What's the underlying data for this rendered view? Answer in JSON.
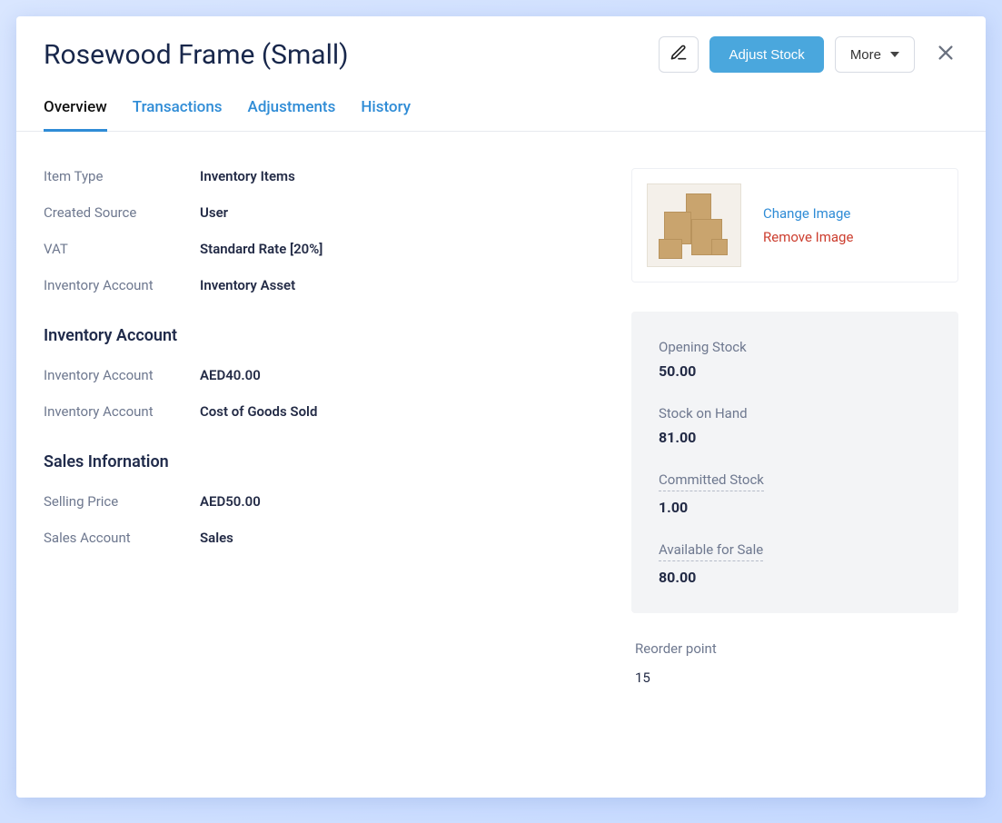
{
  "header": {
    "title": "Rosewood Frame (Small)",
    "adjust_stock_label": "Adjust Stock",
    "more_label": "More"
  },
  "tabs": {
    "overview": "Overview",
    "transactions": "Transactions",
    "adjustments": "Adjustments",
    "history": "History"
  },
  "details": {
    "item_type_label": "Item Type",
    "item_type_value": "Inventory Items",
    "created_source_label": "Created Source",
    "created_source_value": "User",
    "vat_label": "VAT",
    "vat_value": "Standard Rate [20%]",
    "inventory_account_label": "Inventory Account",
    "inventory_account_value": "Inventory Asset"
  },
  "inventory_section": {
    "title": "Inventory Account",
    "row1_label": "Inventory Account",
    "row1_value": "AED40.00",
    "row2_label": "Inventory Account",
    "row2_value": "Cost of Goods Sold"
  },
  "sales_section": {
    "title": "Sales Infornation",
    "selling_price_label": "Selling Price",
    "selling_price_value": "AED50.00",
    "sales_account_label": "Sales Account",
    "sales_account_value": "Sales"
  },
  "image_card": {
    "change_label": "Change Image",
    "remove_label": "Remove Image"
  },
  "stock": {
    "opening_label": "Opening Stock",
    "opening_value": "50.00",
    "on_hand_label": "Stock on Hand",
    "on_hand_value": "81.00",
    "committed_label": "Committed Stock",
    "committed_value": "1.00",
    "available_label": "Available for Sale",
    "available_value": "80.00"
  },
  "reorder": {
    "label": "Reorder point",
    "value": "15"
  }
}
